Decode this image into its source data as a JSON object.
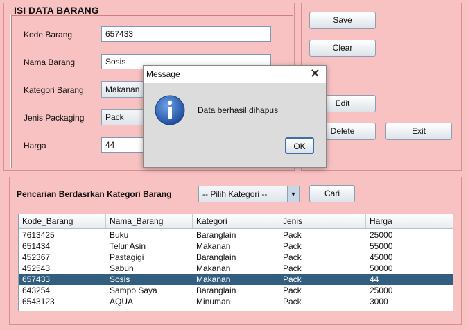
{
  "form": {
    "title": "ISI DATA BARANG",
    "kode_label": "Kode Barang",
    "kode_value": "657433",
    "nama_label": "Nama Barang",
    "nama_value": "Sosis",
    "kategori_label": "Kategori Barang",
    "kategori_value": "Makanan",
    "packaging_label": "Jenis Packaging",
    "packaging_value": "Pack",
    "harga_label": "Harga",
    "harga_value": "44"
  },
  "buttons": {
    "save": "Save",
    "clear": "Clear",
    "edit": "Edit",
    "delete": "Delete",
    "exit": "Exit"
  },
  "search": {
    "label": "Pencarian Berdasrkan Kategori Barang",
    "combo_value": "-- Pilih Kategori --",
    "cari": "Cari"
  },
  "table": {
    "columns": [
      "Kode_Barang",
      "Nama_Barang",
      "Kategori",
      "Jenis",
      "Harga"
    ],
    "rows": [
      [
        "7613425",
        "Buku",
        "Baranglain",
        "Pack",
        "25000"
      ],
      [
        "651434",
        "Telur Asin",
        "Makanan",
        "Pack",
        "55000"
      ],
      [
        "452367",
        "Pastagigi",
        "Baranglain",
        "Pack",
        "45000"
      ],
      [
        "452543",
        "Sabun",
        "Makanan",
        "Pack",
        "50000"
      ],
      [
        "657433",
        "Sosis",
        "Makanan",
        "Pack",
        "44"
      ],
      [
        "643254",
        "Sampo Saya",
        "Baranglain",
        "Pack",
        "25000"
      ],
      [
        "6543123",
        "AQUA",
        "Minuman",
        "Pack",
        "3000"
      ]
    ],
    "selected_row": 4
  },
  "dialog": {
    "title": "Message",
    "message": "Data berhasil dihapus",
    "ok": "OK",
    "icon": "info-icon"
  },
  "colors": {
    "background": "#f8c2c2",
    "selection": "#325f80",
    "info_icon": "#2d5fb4"
  }
}
